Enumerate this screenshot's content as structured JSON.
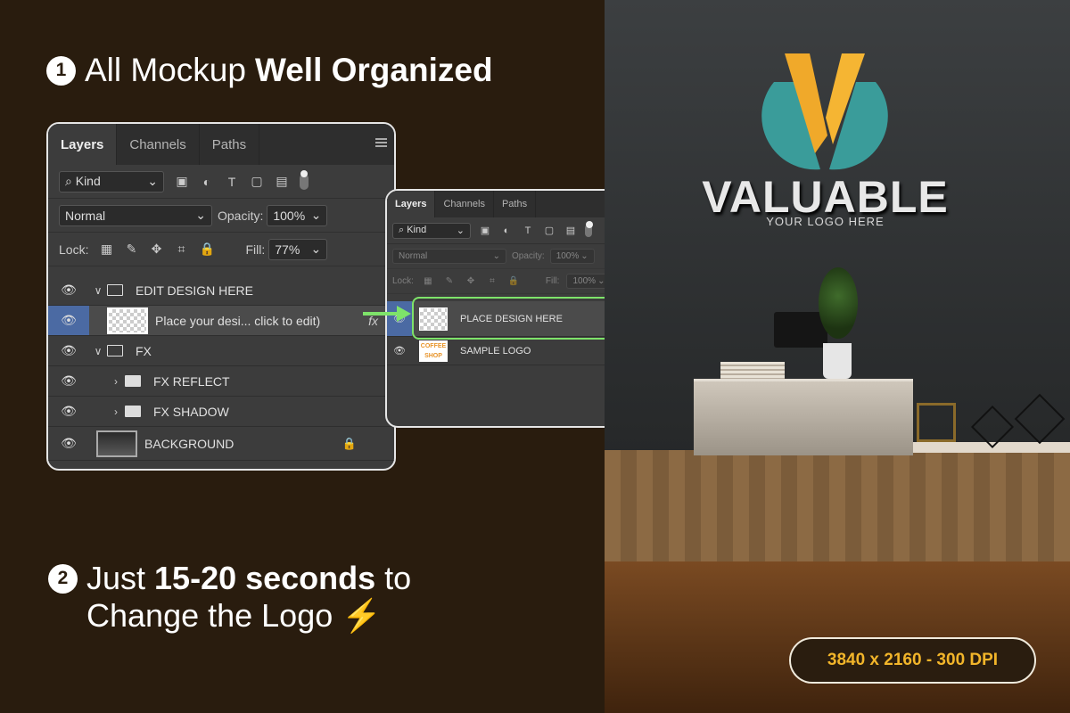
{
  "heading1": {
    "number": "1",
    "text_regular": "All Mockup",
    "text_bold": "Well Organized"
  },
  "heading2": {
    "number": "2",
    "line1_regular": "Just",
    "line1_bold": "15-20 seconds",
    "line1_tail": "to",
    "line2": "Change the Logo",
    "icon": "lightning-bolt-icon"
  },
  "panel_large": {
    "tabs": [
      "Layers",
      "Channels",
      "Paths"
    ],
    "filter_select": "Kind",
    "blend_mode": "Normal",
    "opacity_label": "Opacity:",
    "opacity_value": "100%",
    "lock_label": "Lock:",
    "fill_label": "Fill:",
    "fill_value": "77%",
    "layers": [
      {
        "name": "EDIT DESIGN HERE",
        "type": "group"
      },
      {
        "name": "Place your desi... click to edit)",
        "type": "smart-object",
        "badge": "fx"
      },
      {
        "name": "FX",
        "type": "group"
      },
      {
        "name": "FX REFLECT",
        "type": "group"
      },
      {
        "name": "FX SHADOW",
        "type": "group"
      },
      {
        "name": "BACKGROUND",
        "type": "image"
      }
    ]
  },
  "panel_small": {
    "tabs": [
      "Layers",
      "Channels",
      "Paths"
    ],
    "filter_select": "Kind",
    "blend_mode": "Normal",
    "opacity_label": "Opacity:",
    "opacity_value": "100%",
    "lock_label": "Lock:",
    "fill_label": "Fill:",
    "fill_value": "100%",
    "layers": [
      {
        "name": "PLACE DESIGN HERE",
        "type": "image"
      },
      {
        "name": "SAMPLE LOGO",
        "type": "image",
        "thumb_text": "COFFEE SHOP"
      }
    ]
  },
  "scene": {
    "logo_text": "VALUABLE",
    "logo_sub": "YOUR LOGO HERE"
  },
  "badge": "3840 x 2160 - 300 DPI",
  "colors": {
    "background": "#291c0e",
    "accent_yellow": "#f2b52a",
    "highlight_green": "#7ee36a",
    "selection_blue": "#4b6aa3"
  }
}
